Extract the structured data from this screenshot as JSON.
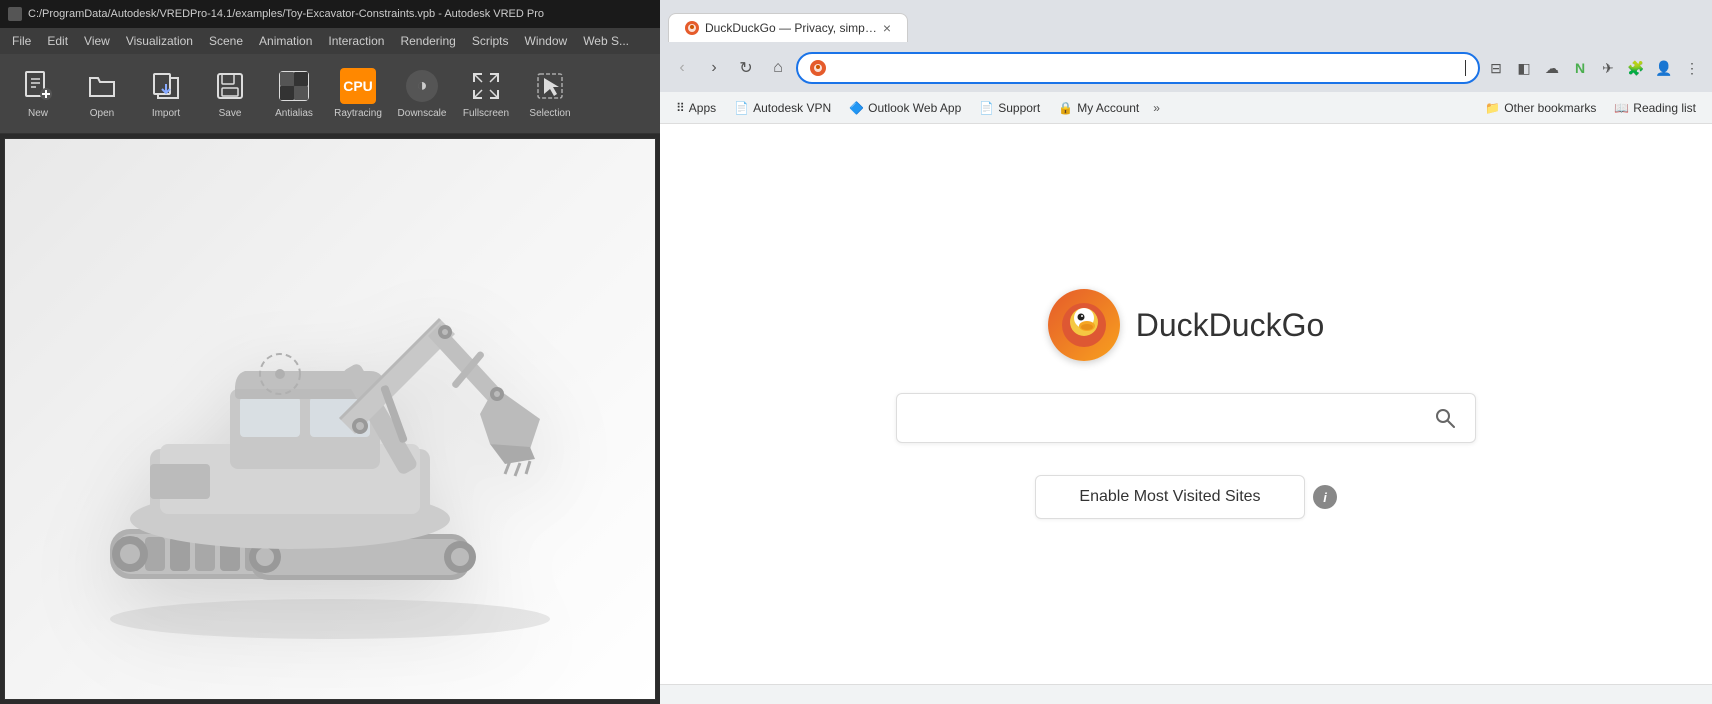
{
  "vred": {
    "titlebar": {
      "text": "C:/ProgramData/Autodesk/VREDPro-14.1/examples/Toy-Excavator-Constraints.vpb - Autodesk VRED Pro"
    },
    "menubar": {
      "items": [
        "File",
        "Edit",
        "View",
        "Visualization",
        "Scene",
        "Animation",
        "Interaction",
        "Rendering",
        "Scripts",
        "Window",
        "Web S..."
      ]
    },
    "toolbar": {
      "buttons": [
        {
          "label": "New",
          "icon": "new-icon"
        },
        {
          "label": "Open",
          "icon": "open-icon"
        },
        {
          "label": "Import",
          "icon": "import-icon"
        },
        {
          "label": "Save",
          "icon": "save-icon"
        },
        {
          "label": "Antialias",
          "icon": "antialias-icon"
        },
        {
          "label": "Raytracing",
          "icon": "raytracing-icon"
        },
        {
          "label": "Downscale",
          "icon": "downscale-icon"
        },
        {
          "label": "Fullscreen",
          "icon": "fullscreen-icon"
        },
        {
          "label": "Selection",
          "icon": "selection-icon"
        }
      ]
    }
  },
  "browser": {
    "tab": {
      "title": "DuckDuckGo — Privacy, simplified.",
      "favicon": "🦆"
    },
    "address": {
      "url": "",
      "placeholder": ""
    },
    "bookmarks": [
      {
        "label": "Apps",
        "icon": "⋮⋮⋮"
      },
      {
        "label": "Autodesk VPN",
        "icon": "📄"
      },
      {
        "label": "Outlook Web App",
        "icon": "🔷"
      },
      {
        "label": "Support",
        "icon": "📄"
      },
      {
        "label": "My Account",
        "icon": "🔒"
      },
      {
        "label": "»",
        "icon": ""
      },
      {
        "label": "Other bookmarks",
        "icon": "📁"
      },
      {
        "label": "Reading list",
        "icon": "📖"
      }
    ]
  },
  "newtab": {
    "logo_text": "DuckDuckGo",
    "search_placeholder": "",
    "enable_button_label": "Enable Most Visited Sites",
    "info_icon_label": "i"
  }
}
